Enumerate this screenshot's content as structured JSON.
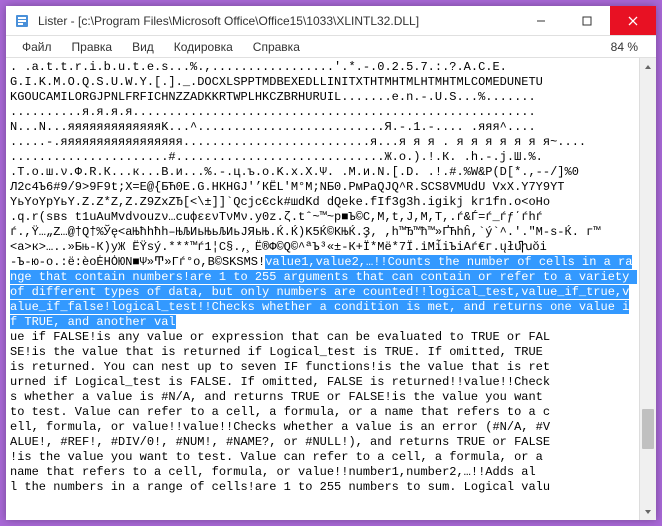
{
  "titlebar": {
    "title": "Lister - [c:\\Program Files\\Microsoft Office\\Office15\\1033\\XLINTL32.DLL]"
  },
  "menu": {
    "file": "Файл",
    "edit": "Правка",
    "view": "Вид",
    "encoding": "Кодировка",
    "help": "Справка",
    "percent": "84 %"
  },
  "content": {
    "line01": ". .a.t.t.r.i.b.u.t.e.s...%.,.................'.*.-.0.2.5.7.:.?.A.C.E.",
    "line02": "G.I.K.M.O.Q.S.U.W.Y.[.]._.DOCXLSPPTMDBEXEDLLINITXTHTMHTMLHTMHTMLCOMEDUNETU",
    "line03": "KGOUCAMILORGJPNLFRFICHNZZADKKRTWPLHKCZBRHURUIL.......e.n.-.U.S...%.......",
    "line04": "..........я.я.я.я........................................................",
    "line05": "N...N...яяяяяяяяяяяяяK...^..........................Я.-.1.-.... .яяя^....",
    "line06": ".....-.яяяяяяяяяяяяяяяяя..........................я...я я я . я я я я я я я~....",
    "line07": "......................#.............................Ж.о.).!.К. .h.-.j.Ш.%.",
    "line08": ".T.о.ш.ν.Φ.R.К...к...В.и...%.-.ц.ъ.о.K.х.Χ.Ψ. .M.и.N.[.D. .!.#.%W&P(D[*.,--/]%0",
    "line09": "Л2с4Ъ6#9/9>9F9t;X=E@{БЋ0E.G.HКHGJ'’КËL'M°M;NБ0.PмPaQJQ^R.SCS8VMUdU VxX.Y7Y9YT",
    "line10": "YьYоYpYьY.Z.Z*Z,Z.Z9ZxZЂ[<\\±]]`QcjcЄck#шdKd dQeke.fIf3g3h.igikj kг1fn.о<оHо",
    "line11": ".q.r(sвs t1uAuMvdνоuzν…сuфεενTνMν.y0z.ζ.tˆ~™~p■Ъ©C,M,t,J,M,T,.ѓ&Ѓ=ѓ_ѓƒ΄ѓhѓ",
    "line12": "ѓ.,Ÿ…„Z…@†Q†%Ўę<аЊћhћh–ЊЉИьЊьЉИьЈЯьЊ.Ќ.Ќ)K5Ќ©КЊЌ.Ҙ‚ ,h™Ђ™ћ™»ҐЋhĥ,`ý`^.'.″M-s-Ќ. г™",
    "line13": "<a>к>…..»Бњ-К)yЖ ЁŸsý.***™ѓ1¦C§.,̧ Ё®Ф©Q©^ªЪ³«±-К+Ї*Mё*7Ї.іMі̃iЪiАѓ€г.ųłﬗŏi",
    "line14": "-Ъ-ю-о.:ё:ѐоĖНȮЮΝ■Ψ»Ͳ»Гѓ°о,B©SKSMS!",
    "highlighted": "value1,value2,…!!Counts the number of cells in a range that contain numbers!are 1 to 255 arguments that can contain or refer to a variety of different types of data, but only numbers are counted!!logical_test,value_if_true,value_if_false!logical_test!!Checks whether a condition is met, and returns one value if TRUE, and another val",
    "line20": "ue if FALSE!is any value or expression that can be evaluated to TRUE or FAL",
    "line21": "SE!is the value that is returned if Logical_test is TRUE. If omitted, TRUE",
    "line22": "is returned. You can nest up to seven IF functions!is the value that is ret",
    "line23": "urned if Logical_test is FALSE. If omitted, FALSE is returned!!value!!Check",
    "line24": "s whether a value is #N/A, and returns TRUE or FALSE!is the value you want",
    "line25": "to test. Value can refer to a cell, a formula, or a name that refers to a c",
    "line26": "ell, formula, or value!!value!!Checks whether a value is an error (#N/A, #V",
    "line27": "ALUE!, #REF!, #DIV/0!, #NUM!, #NAME?, or #NULL!), and returns TRUE or FALSE",
    "line28": "!is the value you want to test. Value can refer to a cell, a formula, or a",
    "line29": "name that refers to a cell, formula, or value!!number1,number2,…!!Adds al",
    "line30": "l the numbers in a range of cells!are 1 to 255 numbers to sum. Logical valu"
  }
}
